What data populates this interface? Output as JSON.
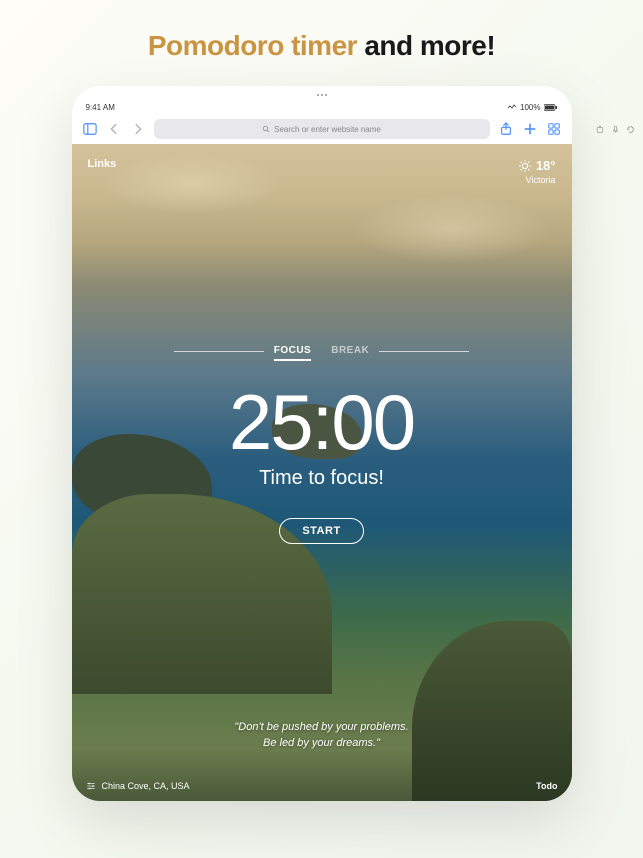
{
  "headline": {
    "accent": "Pomodoro timer",
    "rest": " and more!"
  },
  "statusBar": {
    "time": "9:41 AM",
    "battery": "100%"
  },
  "toolbar": {
    "searchPlaceholder": "Search or enter website name"
  },
  "topRow": {
    "linksLabel": "Links",
    "temperature": "18°",
    "city": "Victoria"
  },
  "pomodoro": {
    "tabFocus": "FOCUS",
    "tabBreak": "BREAK",
    "timer": "25:00",
    "slogan": "Time to focus!",
    "startLabel": "START"
  },
  "quote": {
    "line1": "\"Don't be pushed by your problems.",
    "line2": "Be led by your dreams.\""
  },
  "bottomRow": {
    "location": "China Cove, CA, USA",
    "todoLabel": "Todo"
  }
}
